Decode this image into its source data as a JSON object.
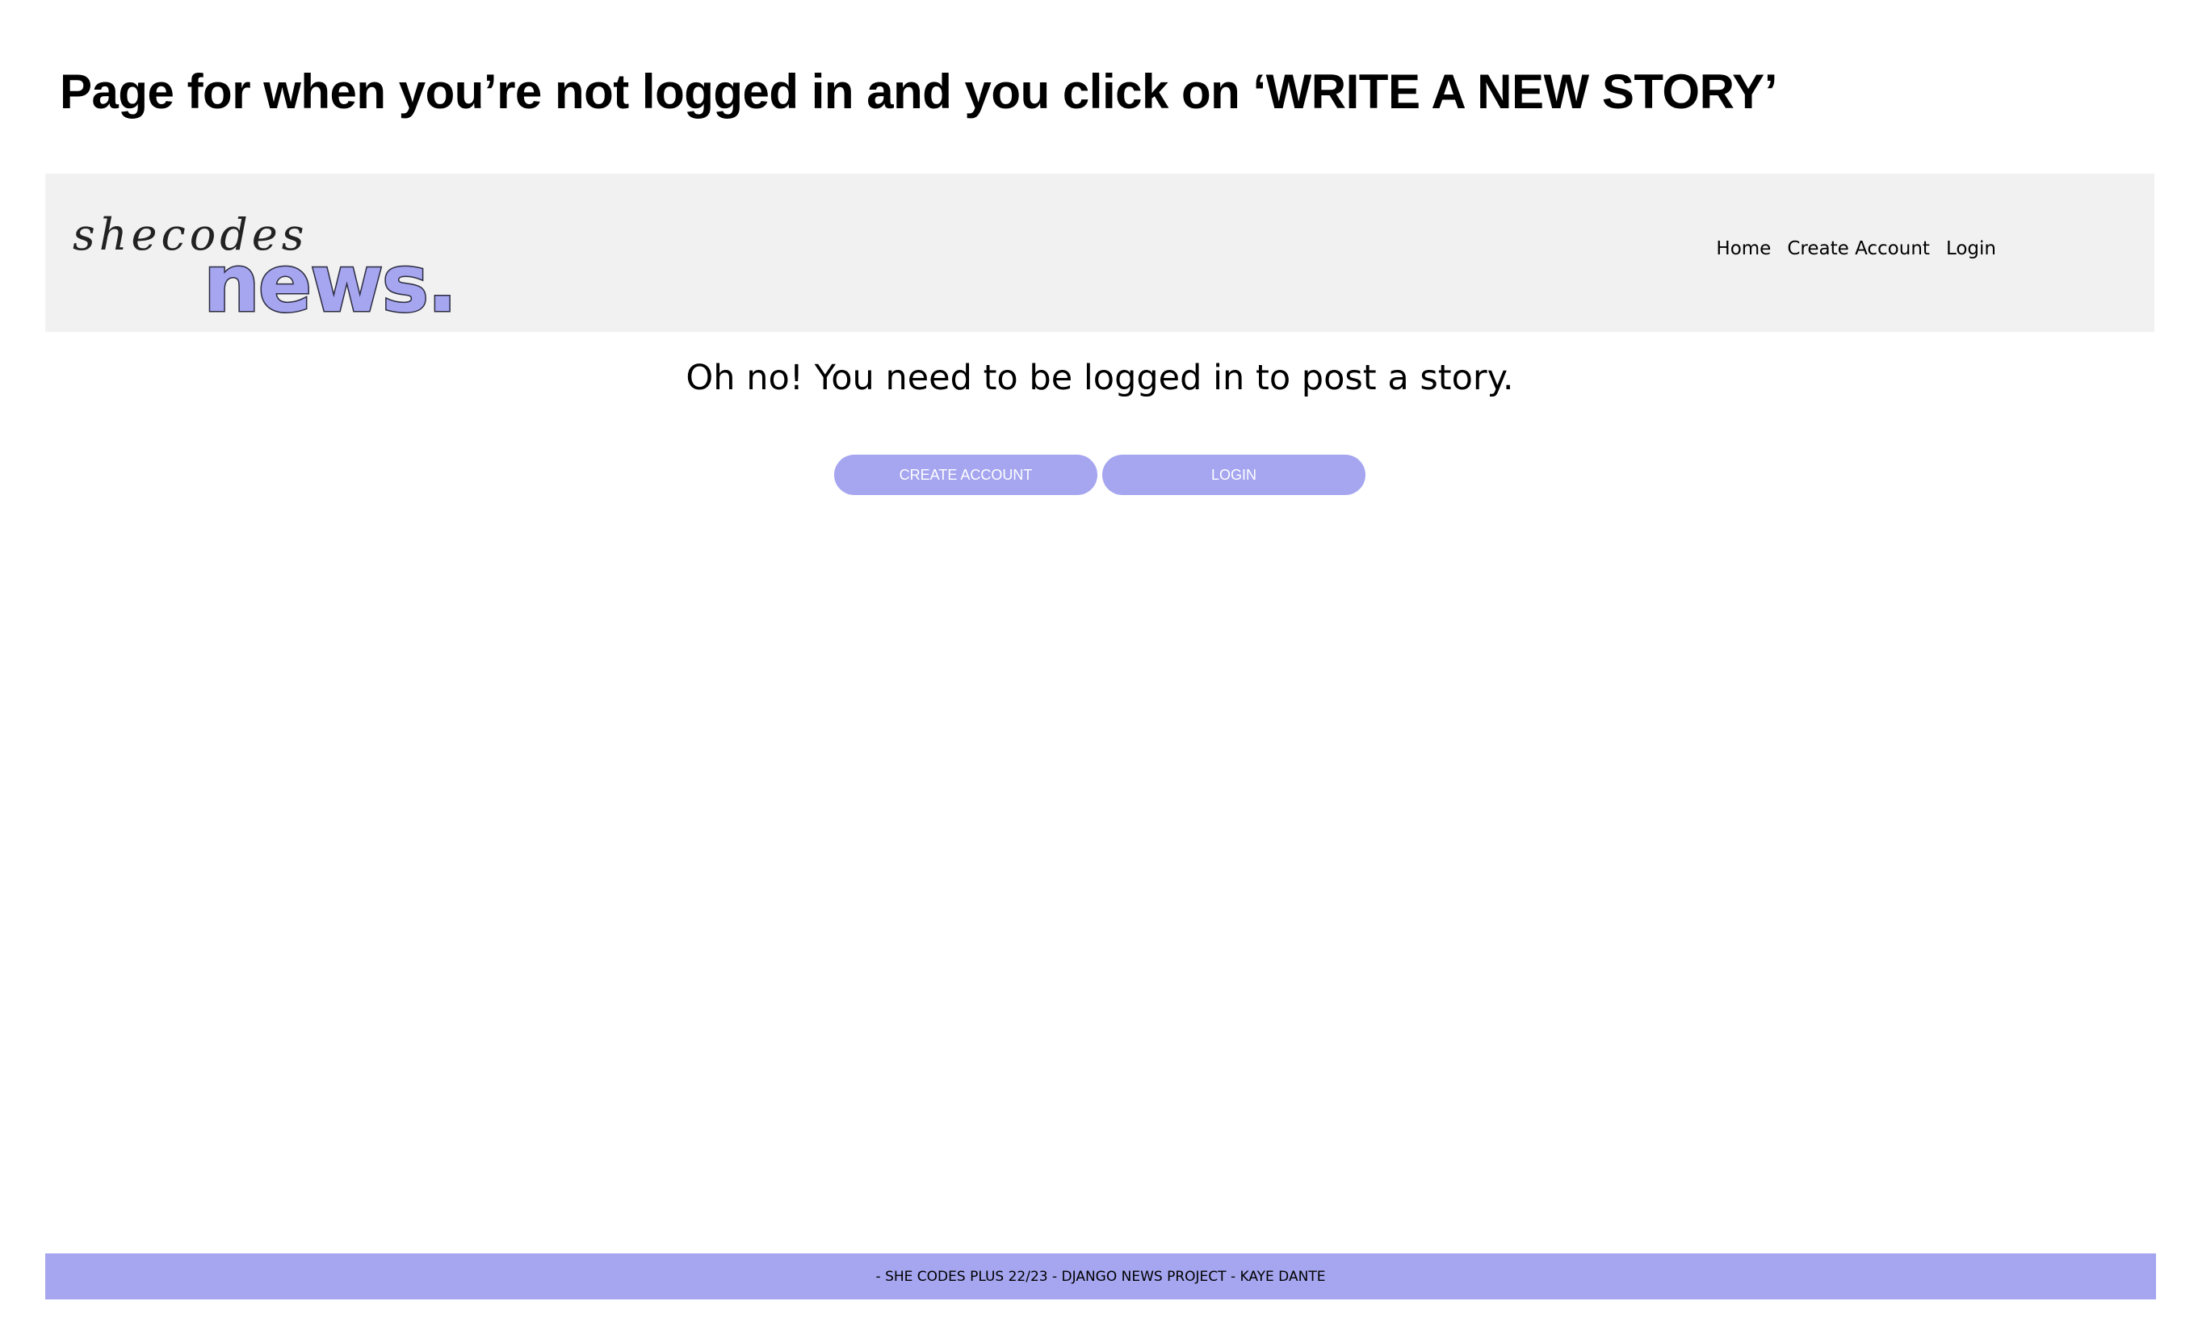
{
  "slide": {
    "title": "Page for when you’re not logged in and you click on ‘WRITE A NEW STORY’"
  },
  "header": {
    "logo": {
      "script_text": "shecodes",
      "word": "news.",
      "accent_color": "#a5a5f0"
    },
    "nav": [
      {
        "label": "Home"
      },
      {
        "label": "Create Account"
      },
      {
        "label": "Login"
      }
    ]
  },
  "main": {
    "message": "Oh no! You need to be logged in to post a story.",
    "buttons": {
      "create_account": "CREATE ACCOUNT",
      "login": "LOGIN"
    }
  },
  "footer": {
    "text": "- SHE CODES PLUS 22/23 - DJANGO NEWS PROJECT - KAYE DANTE"
  },
  "colors": {
    "header_bg": "#f1f1f1",
    "accent": "#a5a5f0",
    "page_bg": "#ffffff"
  }
}
